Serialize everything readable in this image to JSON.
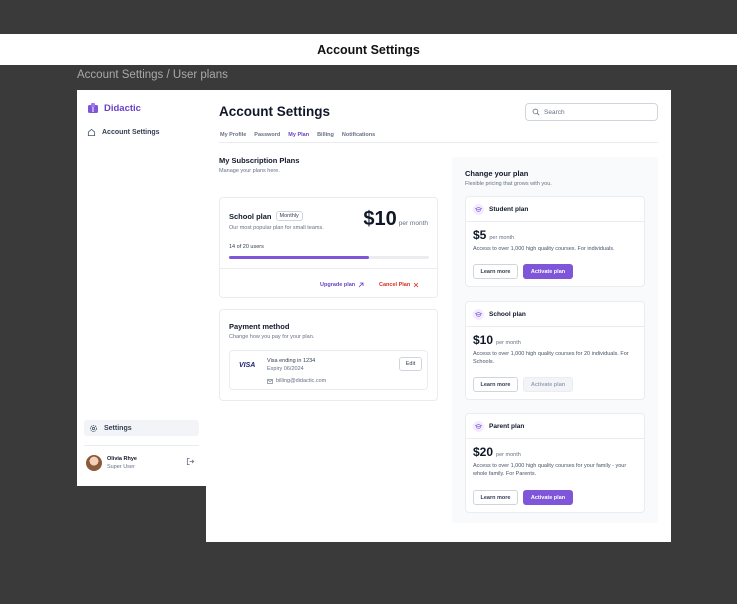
{
  "window": {
    "title": "Account Settings"
  },
  "breadcrumb": "Account Settings / User plans",
  "sidebar": {
    "brand": "Didactic",
    "nav_item": "Account Settings",
    "settings_label": "Settings",
    "user": {
      "name": "Olivia Rhye",
      "role": "Super User"
    }
  },
  "header": {
    "title": "Account Settings",
    "search_placeholder": "Search"
  },
  "tabs": [
    {
      "label": "My Profile",
      "active": false
    },
    {
      "label": "Password",
      "active": false
    },
    {
      "label": "My Plan",
      "active": true
    },
    {
      "label": "Billing",
      "active": false
    },
    {
      "label": "Notifications",
      "active": false
    }
  ],
  "subscription": {
    "title": "My Subscription Plans",
    "subtitle": "Manage your plans here.",
    "plan": {
      "name": "School plan",
      "badge": "Monthly",
      "description": "Our most popular plan for small teams.",
      "price": "$10",
      "per": "per month",
      "users_text": "14 of 20 users",
      "users_used": 14,
      "users_total": 20,
      "upgrade_label": "Upgrade plan",
      "cancel_label": "Cancel Plan"
    }
  },
  "payment": {
    "title": "Payment method",
    "subtitle": "Change how you pay for your plan.",
    "card_brand": "VISA",
    "card_line": "Visa ending in 1234",
    "expiry": "Expiry 06/2024",
    "email": "billing@didactic.com",
    "edit_label": "Edit"
  },
  "change_plan": {
    "title": "Change your plan",
    "subtitle": "Flexible pricing that grows with you.",
    "options": [
      {
        "name": "Student plan",
        "price": "$5",
        "per": "per month",
        "description": "Access to over 1,000 high quality courses. For individuals.",
        "learn_label": "Learn more",
        "activate_label": "Activate plan",
        "disabled": false
      },
      {
        "name": "School plan",
        "price": "$10",
        "per": "per month",
        "description": "Access to over 1,000 high quality courses for 20 individuals. For Schools.",
        "learn_label": "Learn more",
        "activate_label": "Activate plan",
        "disabled": true
      },
      {
        "name": "Parent plan",
        "price": "$20",
        "per": "per month",
        "description": "Access to over 1,000 high quality courses for your family - your whole family. For Parents.",
        "learn_label": "Learn more",
        "activate_label": "Activate plan",
        "disabled": false
      }
    ]
  },
  "colors": {
    "accent": "#7f56d9",
    "accent_text": "#6941c6",
    "danger": "#d92d20"
  },
  "icons": [
    "book-icon",
    "home-icon",
    "gear-icon",
    "logout-icon",
    "search-icon",
    "arrow-up-right-icon",
    "x-icon",
    "mail-icon",
    "graduation-cap-icon"
  ]
}
